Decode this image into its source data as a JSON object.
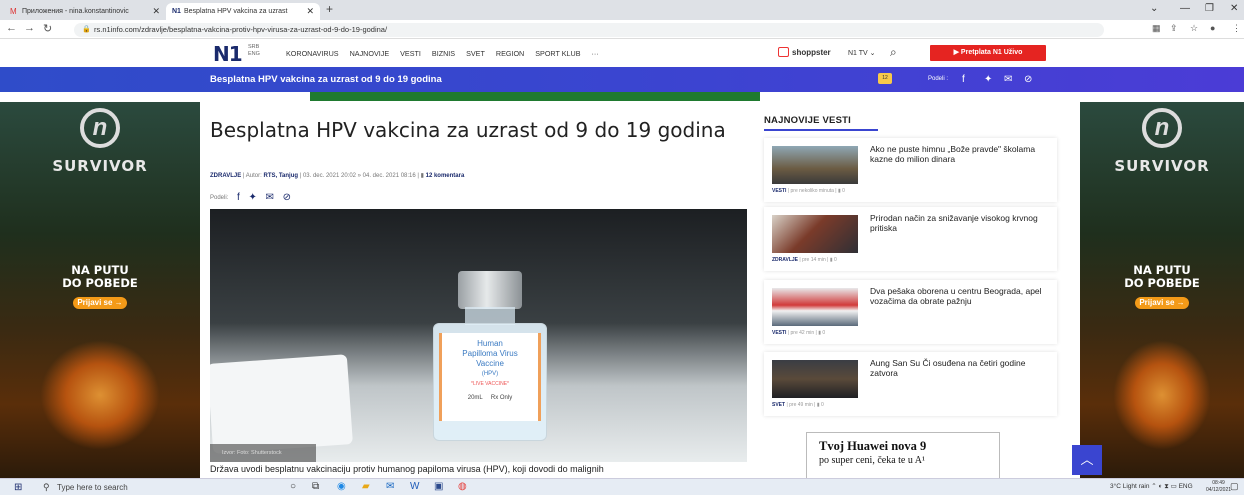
{
  "browser": {
    "tabs": [
      {
        "title": "Приложения - nina.konstantinovic",
        "active": false
      },
      {
        "title": "Besplatna HPV vakcina za uzrast",
        "active": true
      }
    ],
    "url": "rs.n1info.com/zdravlje/besplatna-vakcina-protiv-hpv-virusa-za-uzrast-od-9-do-19-godina/",
    "icons": [
      "back-icon",
      "forward-icon",
      "reload-icon",
      "lock-icon",
      "extensions-icon",
      "share-icon",
      "star-icon",
      "profile-icon",
      "menu-icon"
    ]
  },
  "site": {
    "logo": "N1",
    "lang_primary": "SRB",
    "lang_secondary": "ENG",
    "menu": [
      "KORONAVIRUS",
      "NAJNOVIJE",
      "VESTI",
      "BIZNIS",
      "SVET",
      "REGION",
      "SPORT KLUB",
      "···"
    ],
    "shop": "shoppster",
    "n1tv": "N1 TV",
    "subscribe": "Pretplata N1 Uživo"
  },
  "sticky": {
    "title": "Besplatna HPV vakcina za uzrast od 9 do 19 godina",
    "comment_count": "12",
    "share_label": "Podeli :"
  },
  "ad_side": {
    "brand": "SURVIVOR",
    "line1": "NA PUTU",
    "line2": "DO POBEDE",
    "cta": "Prijavi se"
  },
  "article": {
    "title": "Besplatna HPV vakcina za uzrast od 9 do 19 godina",
    "category": "ZDRAVLJE",
    "author_prefix": "Autor:",
    "authors": "RTS, Tanjug",
    "dates": "03. dec. 2021 20:02 » 04. dec. 2021 08:16",
    "comments": "12 komentara",
    "share_label": "Podeli:",
    "photo_credit": "Izvor: Foto: Shutterstock",
    "vial_label": [
      "Human",
      "Papilloma Virus",
      "Vaccine",
      "(HPV)"
    ],
    "vial_live": "*LIVE VACCINE*",
    "vial_size": "20mL",
    "vial_rx": "Rx Only",
    "lead": "Država uvodi besplatnu vakcinaciju protiv humanog papiloma virusa (HPV), koji dovodi do malignih"
  },
  "najnovije": {
    "heading": "NAJNOVIJE VESTI",
    "items": [
      {
        "headline": "Ako ne puste himnu „Bože pravde\" školama kazne do milion dinara",
        "category": "VESTI",
        "time": "pre nekoliko minuta",
        "comments": "0"
      },
      {
        "headline": "Prirodan način za snižavanje visokog krvnog pritiska",
        "category": "ZDRAVLJE",
        "time": "pre 14 min",
        "comments": "0"
      },
      {
        "headline": "Dva pešaka oborena u centru Beograda, apel vozačima da obrate pažnju",
        "category": "VESTI",
        "time": "pre 42 min",
        "comments": "0"
      },
      {
        "headline": "Aung San Su Či osuđena na četiri godine zatvora",
        "category": "SVET",
        "time": "pre 49 min",
        "comments": "0"
      }
    ]
  },
  "huawei_ad": {
    "line1": "Tvoj Huawei nova 9",
    "line2": "po super ceni, čeka te u A¹"
  },
  "taskbar": {
    "search_placeholder": "Type here to search",
    "weather": "3°C  Light rain",
    "lang": "ENG",
    "time": "08:49",
    "date": "04/12/2021"
  }
}
